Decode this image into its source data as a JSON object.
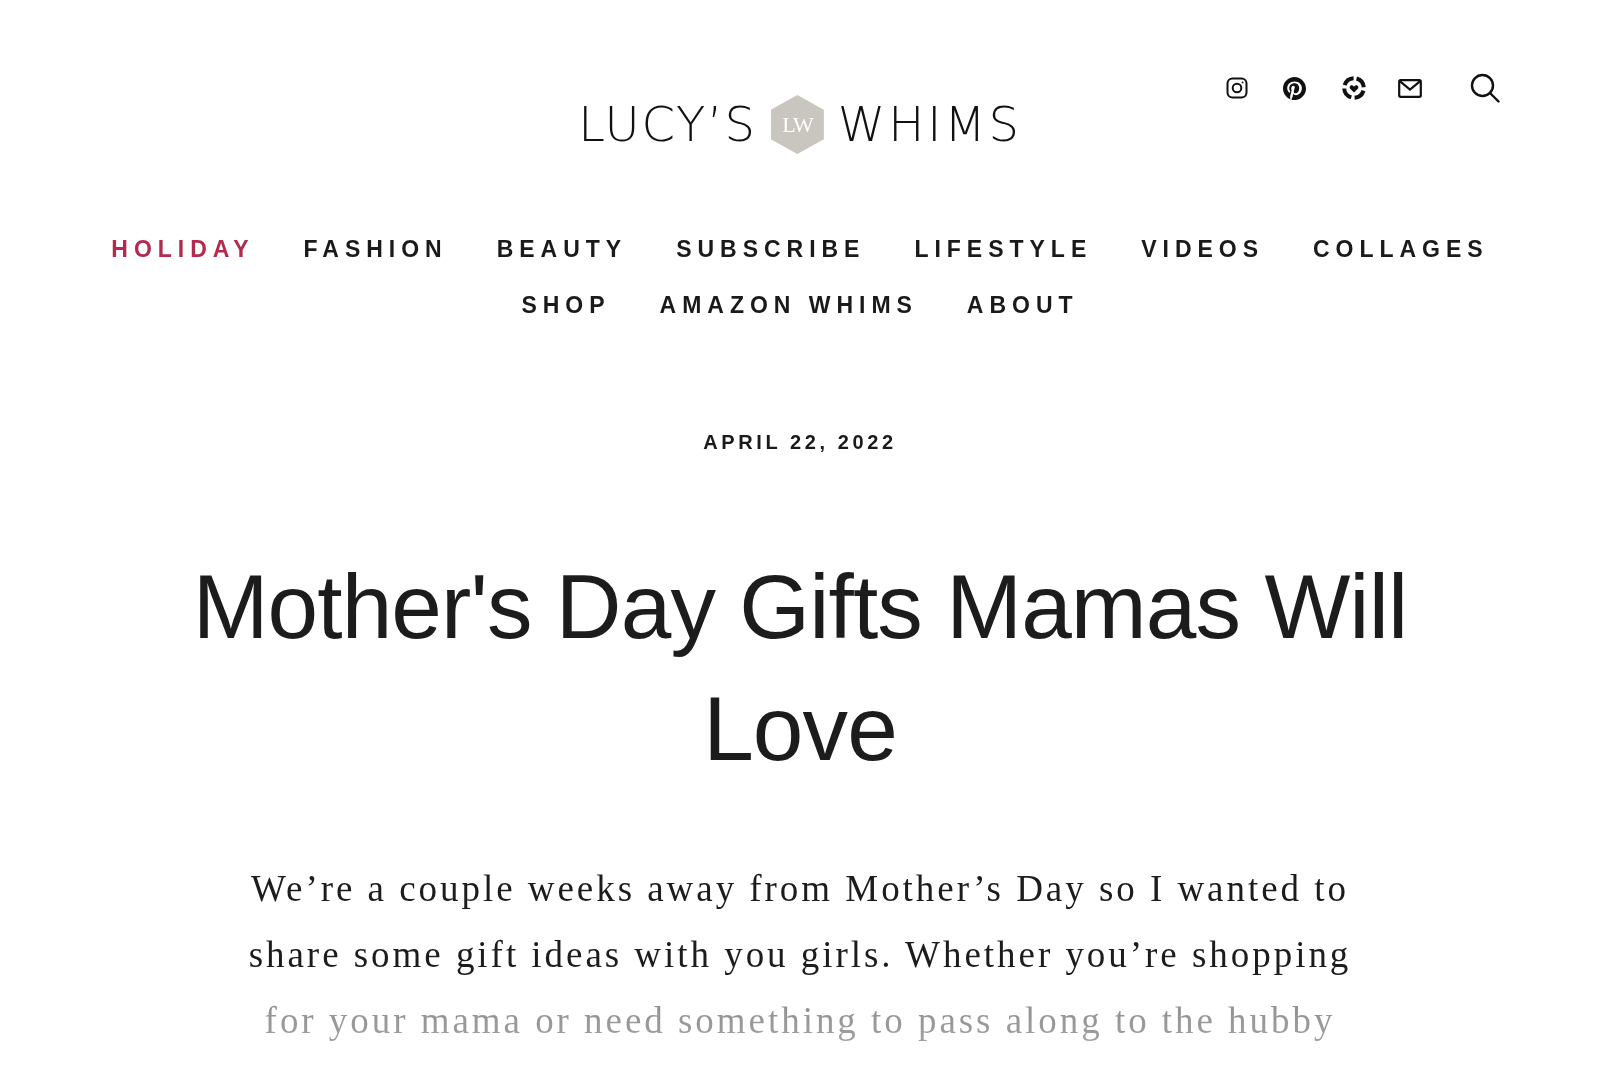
{
  "header": {
    "logo": {
      "left": "LUCY’S",
      "monogram": "LW",
      "right": "WHIMS"
    }
  },
  "nav": {
    "items": [
      {
        "label": "HOLIDAY",
        "selected": true
      },
      {
        "label": "FASHION",
        "selected": false
      },
      {
        "label": "BEAUTY",
        "selected": false
      },
      {
        "label": "SUBSCRIBE",
        "selected": false
      },
      {
        "label": "LIFESTYLE",
        "selected": false
      },
      {
        "label": "VIDEOS",
        "selected": false
      },
      {
        "label": "COLLAGES",
        "selected": false
      },
      {
        "label": "SHOP",
        "selected": false
      },
      {
        "label": "AMAZON WHIMS",
        "selected": false
      },
      {
        "label": "ABOUT",
        "selected": false
      }
    ]
  },
  "post": {
    "date": "APRIL 22, 2022",
    "title": "Mother's Day Gifts Mamas Will Love",
    "intro": "We’re a couple weeks away from Mother’s Day so I wanted to share some gift ideas with you girls. Whether you’re shopping for your mama or need something to pass along to the hubby"
  }
}
